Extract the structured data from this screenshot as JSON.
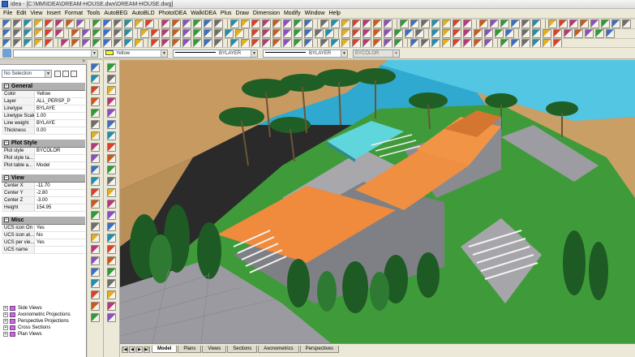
{
  "window": {
    "title": "idea - [C:\\MM\\IDEA\\DREAM-HOUSE.dwx\\DREAM-HOUSE.dwg]"
  },
  "menu": [
    "File",
    "Edit",
    "View",
    "Insert",
    "Format",
    "Tools",
    "AutoBEG",
    "AutoBLD",
    "PhotoIDEA",
    "WalkIDEA",
    "Plus",
    "Draw",
    "Dimension",
    "Modify",
    "Window",
    "Help"
  ],
  "props_bar": {
    "color": "Yellow",
    "linetype": "BYLAYER",
    "lineweight": "BYLAYER",
    "plotstyle": "BYCOLOR"
  },
  "left_panel": {
    "selection": "No Selection",
    "sections": [
      {
        "title": "General",
        "rows": [
          {
            "k": "Color",
            "v": "Yellow"
          },
          {
            "k": "Layer",
            "v": "ALL_PERSP_P"
          },
          {
            "k": "Linetype",
            "v": "BYLAYE"
          },
          {
            "k": "Linetype Scale",
            "v": "1.00"
          },
          {
            "k": "Line weight",
            "v": "BYLAYE"
          },
          {
            "k": "Thickness",
            "v": "0.00"
          }
        ]
      },
      {
        "title": "Plot Style",
        "rows": [
          {
            "k": "Plot style",
            "v": "BYCOLOR"
          },
          {
            "k": "Plot style ta...",
            "v": ""
          },
          {
            "k": "Plot table a...",
            "v": "Model"
          }
        ]
      },
      {
        "title": "View",
        "rows": [
          {
            "k": "Center X",
            "v": "-11.70"
          },
          {
            "k": "Center Y",
            "v": "-2.80"
          },
          {
            "k": "Center Z",
            "v": "-3.00"
          },
          {
            "k": "Height",
            "v": "154.95"
          }
        ]
      },
      {
        "title": "Misc",
        "rows": [
          {
            "k": "UCS icon On",
            "v": "Yes"
          },
          {
            "k": "UCS icon at...",
            "v": "No"
          },
          {
            "k": "UCS per vie...",
            "v": "Yes"
          },
          {
            "k": "UCS name",
            "v": ""
          }
        ]
      }
    ],
    "tree": [
      "Side Views",
      "Axonometric Projections",
      "Perspective Projections",
      "Cross Sections",
      "Plan Views"
    ]
  },
  "layout_tabs": [
    "Model",
    "Plans",
    "Views",
    "Sections",
    "Axonometrics",
    "Perspectives"
  ],
  "colors": {
    "sea": "#3fb6d6",
    "sand": "#c9a06a",
    "grass": "#3f9b3a",
    "roof": "#f08a3c",
    "wall": "#8c8c92",
    "pool": "#5fd0d8",
    "paving": "#a8a8ac"
  }
}
